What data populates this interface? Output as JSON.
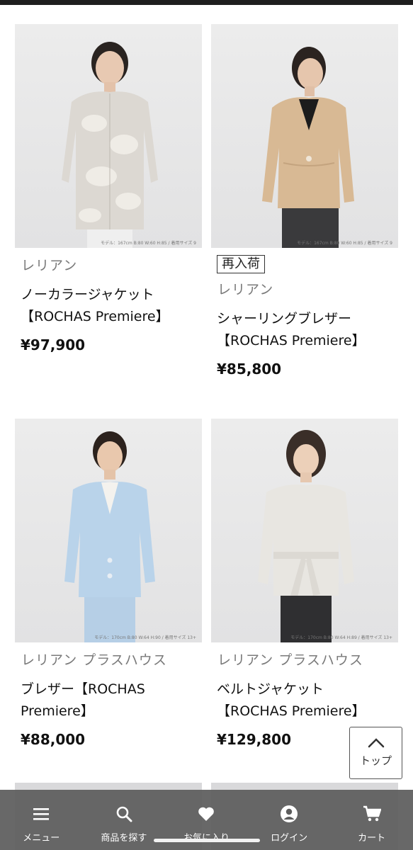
{
  "products": [
    {
      "brand": "レリアン",
      "name": "ノーカラージャケット【ROCHAS Premiere】",
      "price": "¥97,900",
      "badge": "",
      "photo_caption": "モデル：167cm B:80 W:60 H:85 / 着用サイズ 9"
    },
    {
      "brand": "レリアン",
      "name": "シャーリングブレザー【ROCHAS Premiere】",
      "price": "¥85,800",
      "badge": "再入荷",
      "photo_caption": "モデル：167cm B:80 W:60 H:85 / 着用サイズ 9"
    },
    {
      "brand": "レリアン プラスハウス",
      "name": "ブレザー【ROCHAS Premiere】",
      "price": "¥88,000",
      "badge": "",
      "photo_caption": "モデル：170cm B:80 W:64 H:90 / 着用サイズ 13+"
    },
    {
      "brand": "レリアン プラスハウス",
      "name": "ベルトジャケット【ROCHAS Premiere】",
      "price": "¥129,800",
      "badge": "",
      "photo_caption": "モデル：170cm B:80 W:64 H:89 / 着用サイズ 13+"
    }
  ],
  "scroll_top": {
    "label": "トップ",
    "icon": "chevron-up-icon"
  },
  "bottom_nav": [
    {
      "label": "メニュー",
      "icon": "menu-icon"
    },
    {
      "label": "商品を探す",
      "icon": "search-icon"
    },
    {
      "label": "お気に入り",
      "icon": "heart-icon"
    },
    {
      "label": "ログイン",
      "icon": "user-icon"
    },
    {
      "label": "カート",
      "icon": "cart-icon"
    }
  ],
  "colors": {
    "nav_bg": "#5c5c5c",
    "brand_text": "#7a7a7a",
    "price_text": "#111111"
  }
}
